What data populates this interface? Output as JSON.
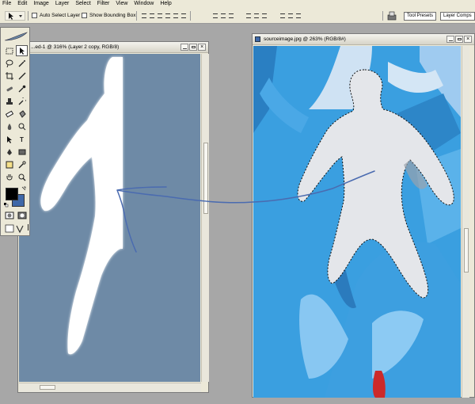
{
  "menu": [
    "File",
    "Edit",
    "Image",
    "Layer",
    "Select",
    "Filter",
    "View",
    "Window",
    "Help"
  ],
  "options_bar": {
    "auto_select_label": "Auto Select Layer",
    "auto_select_checked": false,
    "bounding_box_label": "Show Bounding Box",
    "bounding_box_checked": false,
    "palette_tabs": [
      "Tool Presets",
      "Layer Comps"
    ]
  },
  "left_doc": {
    "title": "...ed-1 @ 316% (Layer 2 copy, RGB/8)"
  },
  "right_doc": {
    "title": "sourceimage.jpg @ 263% (RGB/8#)"
  },
  "tools": {
    "icons": [
      "feather-logo-icon",
      "marquee-icon",
      "move-icon",
      "lasso-icon",
      "magic-wand-icon",
      "crop-icon",
      "slice-icon",
      "healing-icon",
      "brush-icon",
      "stamp-icon",
      "history-brush-icon",
      "eraser-icon",
      "bucket-icon",
      "blur-icon",
      "dodge-icon",
      "path-select-icon",
      "type-icon",
      "pen-icon",
      "shape-icon",
      "notes-icon",
      "eyedropper-icon",
      "hand-icon",
      "zoom-icon",
      "quick-mask-off-icon",
      "quick-mask-on-icon",
      "screen-mode-1-icon",
      "screen-mode-2-icon",
      "screen-mode-3-icon",
      "jump-to-imageready-icon"
    ],
    "type_glyph": "T"
  },
  "colors": {
    "foreground": "#000000",
    "background": "#3f68a8",
    "left_canvas": "#6e8aa6",
    "right_canvas": "#3399dd",
    "stroke": "#4a6bb0",
    "chrome": "#ece9d8"
  }
}
